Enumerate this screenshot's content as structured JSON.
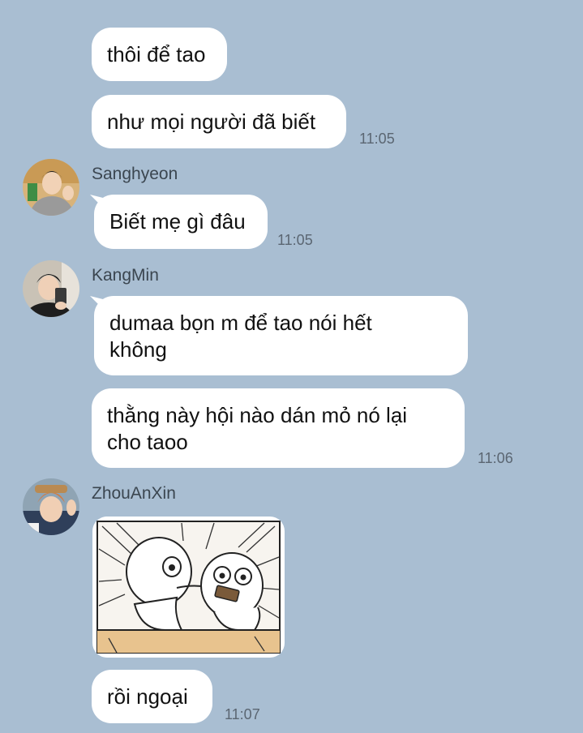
{
  "messages": {
    "m1": "thôi để tao",
    "m2": "như mọi người đã biết",
    "m2_time": "11:05",
    "m3_sender": "Sanghyeon",
    "m3": "Biết mẹ gì đâu",
    "m3_time": "11:05",
    "m4_sender": "KangMin",
    "m4_line1": "dumaa bọn m để tao nói hết",
    "m4_line2": "không",
    "m5_line1": "thằng này hội nào dán mỏ nó lại",
    "m5_line2": "cho taoo",
    "m5_time": "11:06",
    "m6_sender": "ZhouAnXin",
    "m7": "rồi ngoại",
    "m7_time": "11:07"
  },
  "colors": {
    "background": "#a9bed2",
    "bubble": "#ffffff",
    "timestamp": "#5b6672"
  },
  "icons": [
    "avatar-sanghyeon",
    "avatar-kangmin",
    "avatar-zhouanxin",
    "sticker-image"
  ]
}
